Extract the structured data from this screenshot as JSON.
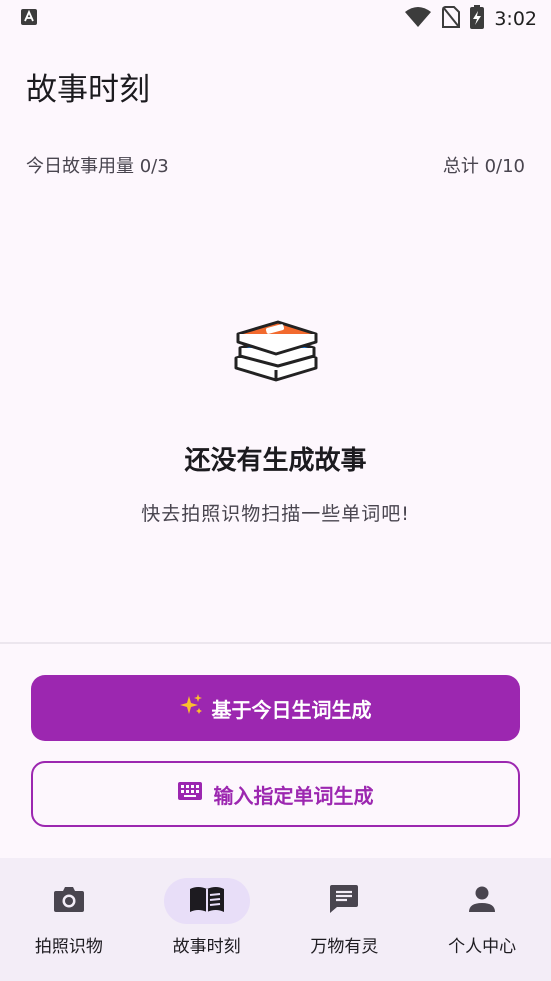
{
  "status_bar": {
    "time": "3:02",
    "icons": [
      "notification-a-icon",
      "wifi-icon",
      "no-sim-icon",
      "battery-charging-icon"
    ]
  },
  "header": {
    "title": "故事时刻"
  },
  "usage": {
    "daily": "今日故事用量 0/3",
    "total": "总计 0/10"
  },
  "empty_state": {
    "icon": "books-icon",
    "title": "还没有生成故事",
    "subtitle": "快去拍照识物扫描一些单词吧!"
  },
  "actions": {
    "primary": {
      "label": "基于今日生词生成",
      "icon": "sparkle-icon"
    },
    "secondary": {
      "label": "输入指定单词生成",
      "icon": "keyboard-icon"
    }
  },
  "bottom_nav": {
    "items": [
      {
        "label": "拍照识物",
        "icon": "camera-icon"
      },
      {
        "label": "故事时刻",
        "icon": "book-icon",
        "active": true
      },
      {
        "label": "万物有灵",
        "icon": "chat-icon"
      },
      {
        "label": "个人中心",
        "icon": "person-icon"
      }
    ]
  },
  "colors": {
    "accent": "#9c27b0",
    "background": "#fdf7fd",
    "nav_background": "#f3edf7",
    "nav_active_pill": "#e8def8"
  }
}
